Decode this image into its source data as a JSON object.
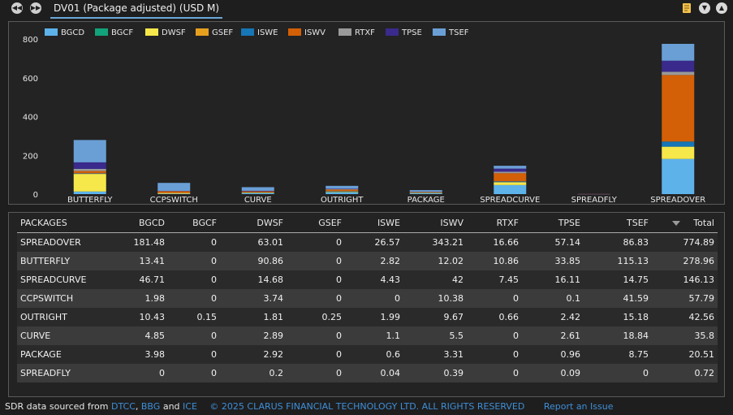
{
  "header": {
    "title": "DV01 (Package adjusted) (USD M)",
    "nav_back_icon": "rewind-icon",
    "nav_forward_icon": "fast-forward-icon",
    "tools": [
      "note-icon",
      "chevron-down-icon",
      "chevron-up-icon"
    ]
  },
  "chart_data": {
    "type": "bar",
    "stacked": true,
    "categories": [
      "BUTTERFLY",
      "CCPSWITCH",
      "CURVE",
      "OUTRIGHT",
      "PACKAGE",
      "SPREADCURVE",
      "SPREADFLY",
      "SPREADOVER"
    ],
    "ylim": [
      0,
      800
    ],
    "yticks": [
      0,
      200,
      400,
      600,
      800
    ],
    "legend_position": "top-left",
    "grid": false,
    "series": [
      {
        "name": "BGCD",
        "color": "#5db2ea",
        "values": [
          13.41,
          1.98,
          4.85,
          10.43,
          3.98,
          46.71,
          0,
          181.48
        ]
      },
      {
        "name": "BGCF",
        "color": "#12a37a",
        "values": [
          0,
          0,
          0,
          0.15,
          0,
          0,
          0,
          0
        ]
      },
      {
        "name": "DWSF",
        "color": "#f6e84a",
        "values": [
          90.86,
          3.74,
          2.89,
          1.81,
          2.92,
          14.68,
          0.2,
          63.01
        ]
      },
      {
        "name": "GSEF",
        "color": "#e6a01e",
        "values": [
          0,
          0,
          0,
          0.25,
          0,
          0,
          0,
          0
        ]
      },
      {
        "name": "ISWE",
        "color": "#1676b6",
        "values": [
          2.82,
          0,
          1.1,
          1.99,
          0.6,
          4.43,
          0.04,
          26.57
        ]
      },
      {
        "name": "ISWV",
        "color": "#d35f06",
        "values": [
          12.02,
          10.38,
          5.5,
          9.67,
          3.31,
          42,
          0.39,
          343.21
        ]
      },
      {
        "name": "RTXF",
        "color": "#9a9a9a",
        "values": [
          10.86,
          0,
          0,
          0.66,
          0,
          7.45,
          0,
          16.66
        ]
      },
      {
        "name": "TPSE",
        "color": "#3a2a8c",
        "values": [
          33.85,
          0.1,
          2.61,
          2.42,
          0.96,
          16.11,
          0.09,
          57.14
        ]
      },
      {
        "name": "TSEF",
        "color": "#6a9fd6",
        "values": [
          115.13,
          41.59,
          18.84,
          15.18,
          8.75,
          14.75,
          0,
          86.83
        ]
      }
    ]
  },
  "table": {
    "columns": [
      "PACKAGES",
      "BGCD",
      "BGCF",
      "DWSF",
      "GSEF",
      "ISWE",
      "ISWV",
      "RTXF",
      "TPSE",
      "TSEF",
      "Total"
    ],
    "sorted_column": "TSEF",
    "rows": [
      [
        "SPREADOVER",
        "181.48",
        "0",
        "63.01",
        "0",
        "26.57",
        "343.21",
        "16.66",
        "57.14",
        "86.83",
        "774.89"
      ],
      [
        "BUTTERFLY",
        "13.41",
        "0",
        "90.86",
        "0",
        "2.82",
        "12.02",
        "10.86",
        "33.85",
        "115.13",
        "278.96"
      ],
      [
        "SPREADCURVE",
        "46.71",
        "0",
        "14.68",
        "0",
        "4.43",
        "42",
        "7.45",
        "16.11",
        "14.75",
        "146.13"
      ],
      [
        "CCPSWITCH",
        "1.98",
        "0",
        "3.74",
        "0",
        "0",
        "10.38",
        "0",
        "0.1",
        "41.59",
        "57.79"
      ],
      [
        "OUTRIGHT",
        "10.43",
        "0.15",
        "1.81",
        "0.25",
        "1.99",
        "9.67",
        "0.66",
        "2.42",
        "15.18",
        "42.56"
      ],
      [
        "CURVE",
        "4.85",
        "0",
        "2.89",
        "0",
        "1.1",
        "5.5",
        "0",
        "2.61",
        "18.84",
        "35.8"
      ],
      [
        "PACKAGE",
        "3.98",
        "0",
        "2.92",
        "0",
        "0.6",
        "3.31",
        "0",
        "0.96",
        "8.75",
        "20.51"
      ],
      [
        "SPREADFLY",
        "0",
        "0",
        "0.2",
        "0",
        "0.04",
        "0.39",
        "0",
        "0.09",
        "0",
        "0.72"
      ]
    ]
  },
  "footer": {
    "source_prefix": "SDR data sourced from",
    "link_dtcc": "DTCC",
    "sep1": ",",
    "link_bbg": "BBG",
    "and_text": "and",
    "link_ice": "ICE",
    "copyright": "© 2025 CLARUS FINANCIAL TECHNOLOGY LTD. ALL RIGHTS RESERVED",
    "report_link": "Report an Issue"
  }
}
